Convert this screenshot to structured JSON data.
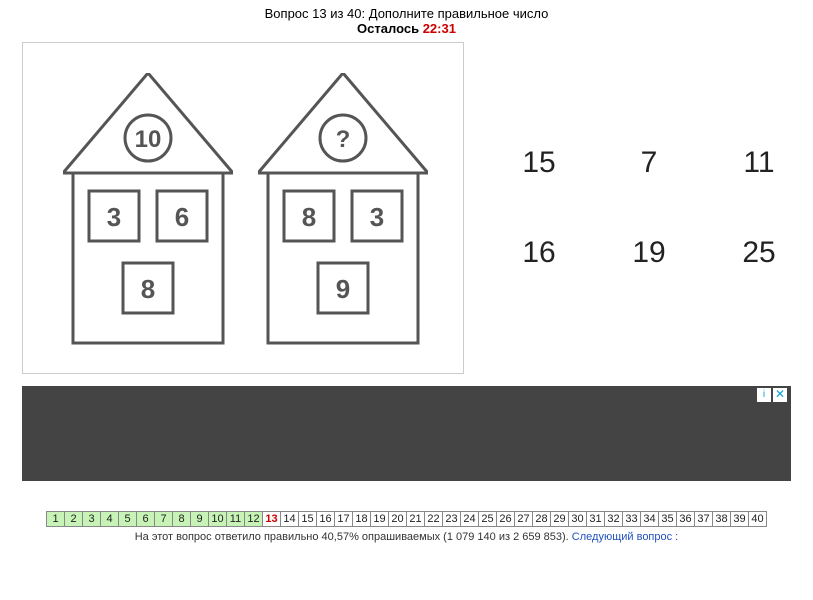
{
  "header": {
    "question_line": "Вопрос 13 из 40: Дополните правильное число",
    "timer_label": "Осталось ",
    "timer_value": "22:31"
  },
  "houses": [
    {
      "circle": "10",
      "box_tl": "3",
      "box_tr": "6",
      "box_b": "8"
    },
    {
      "circle": "?",
      "box_tl": "8",
      "box_tr": "3",
      "box_b": "9"
    }
  ],
  "answers": [
    "15",
    "7",
    "11",
    "16",
    "19",
    "25"
  ],
  "nav": {
    "total": 40,
    "current": 13,
    "answered_upto": 12
  },
  "footer": {
    "stats": "На этот вопрос ответило правильно 40,57% опрашиваемых (1 079 140 из 2 659 853). ",
    "next_label": "Следующий вопрос :"
  },
  "ad": {
    "info": "i",
    "close": "✕"
  }
}
